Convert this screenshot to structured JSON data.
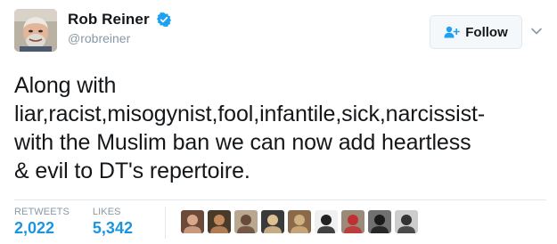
{
  "user": {
    "display_name": "Rob Reiner",
    "handle": "@robreiner",
    "verified_icon": "verified-badge-icon"
  },
  "follow_button": {
    "label": "Follow",
    "icon": "add-user-icon"
  },
  "tweet": {
    "text": "Along with\nliar,racist,misogynist,fool,infantile,sick,narcissist-\nwith the Muslim ban we can now add heartless\n& evil to DT's repertoire."
  },
  "stats": {
    "retweets_label": "RETWEETS",
    "retweets_value": "2,022",
    "likes_label": "LIKES",
    "likes_value": "5,342"
  },
  "likers": [
    {
      "name": "liker-avatar-1",
      "bg": "#6b4a3a",
      "fg": "#d9a78a"
    },
    {
      "name": "liker-avatar-2",
      "bg": "#4a3a2a",
      "fg": "#c48a5c"
    },
    {
      "name": "liker-avatar-3",
      "bg": "#b8a890",
      "fg": "#6a4a3a"
    },
    {
      "name": "liker-avatar-4",
      "bg": "#3a3a3a",
      "fg": "#e0c090"
    },
    {
      "name": "liker-avatar-5",
      "bg": "#8a6a4a",
      "fg": "#d0b080"
    },
    {
      "name": "liker-avatar-6",
      "bg": "#f0f0f0",
      "fg": "#222222"
    },
    {
      "name": "liker-avatar-7",
      "bg": "#9a8a7a",
      "fg": "#c03030"
    },
    {
      "name": "liker-avatar-8",
      "bg": "#707070",
      "fg": "#1a1a1a"
    },
    {
      "name": "liker-avatar-9",
      "bg": "#cccccc",
      "fg": "#333333"
    }
  ],
  "colors": {
    "link_blue": "#1b95e0",
    "verified_blue": "#1da1f2",
    "muted_gray": "#8899a6",
    "border": "#e1e8ed"
  }
}
